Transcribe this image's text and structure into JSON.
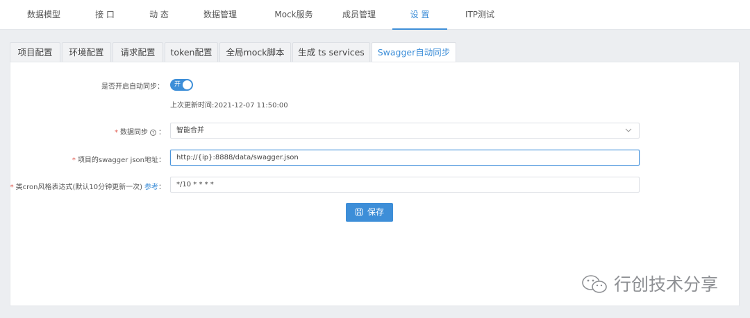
{
  "topnav": {
    "items": [
      {
        "label": "数据模型"
      },
      {
        "label": "接 口"
      },
      {
        "label": "动 态"
      },
      {
        "label": "数据管理"
      },
      {
        "label": "Mock服务"
      },
      {
        "label": "成员管理"
      },
      {
        "label": "设 置",
        "active": true
      },
      {
        "label": "ITP测试"
      }
    ]
  },
  "tabs": [
    {
      "label": "项目配置"
    },
    {
      "label": "环境配置"
    },
    {
      "label": "请求配置"
    },
    {
      "label": "token配置"
    },
    {
      "label": "全局mock脚本"
    },
    {
      "label": "生成 ts services"
    },
    {
      "label": "Swagger自动同步",
      "active": true
    }
  ],
  "form": {
    "auto_sync": {
      "label": "是否开启自动同步：",
      "switch_text": "开",
      "enabled": true
    },
    "last_updated": "上次更新时间:2021-12-07 11:50:00",
    "data_sync": {
      "required_mark": "*",
      "label": "数据同步",
      "help_glyph": "?",
      "colon": "：",
      "value": "智能合并"
    },
    "swagger_url": {
      "required_mark": "*",
      "label": "项目的swagger json地址：",
      "value": "http://{ip}:8888/data/swagger.json"
    },
    "cron": {
      "required_mark": "*",
      "label": "类cron风格表达式(默认10分钟更新一次)",
      "link": "参考",
      "colon": "：",
      "value": "*/10 * * * *"
    },
    "save_label": "保存"
  },
  "watermark": {
    "text": "行创技术分享"
  },
  "colors": {
    "accent": "#3d8ed8",
    "required": "#e05a4f"
  },
  "icons": {
    "select_arrow": "chevron-down-icon",
    "save": "save-icon",
    "watermark": "wechat-icon",
    "help": "help-circle-icon"
  }
}
